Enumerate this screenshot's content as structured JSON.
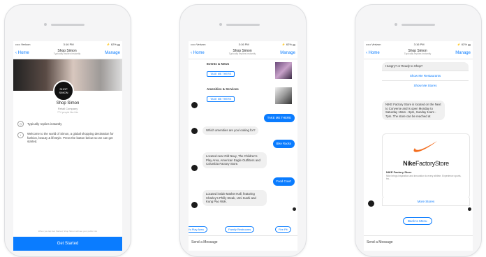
{
  "status": {
    "carrier": "••••• Verizon",
    "time": "3:16 PM",
    "battery": "⚡ 62% ▬"
  },
  "nav": {
    "back": "Home",
    "manage": "Manage",
    "title": "Shop Simon",
    "subtitle": "Typically replies instantly"
  },
  "phone1": {
    "logo_line1": "SHOP",
    "logo_line2": "SIMON",
    "page_name": "Shop Simon",
    "page_type": "Retail Company",
    "likes": "774 people like this",
    "replies": "Typically replies instantly",
    "welcome": "Welcome to the world of Simon, a global shopping destination for fashion, beauty & lifestyle. Press the button below so we can get started.",
    "disclaimer": "When you tap Get Started, Shop Simon will see your public info",
    "get_started": "Get Started"
  },
  "phone2": {
    "card1_title": "Events & News",
    "card1_btn": "TAKE ME THERE",
    "card2_title": "Amenities & Services",
    "card2_btn": "TAKE ME THERE",
    "out1": "TAKE ME THERE",
    "in1": "Which amenities are you looking for?",
    "out2": "Bike Racks",
    "in2": "Located near Old Navy, The Children's Play Area, American Eagle Outfitters and Columbia Factory Store.",
    "out3": "Food Court",
    "in3": "Located inside Market Hall, featuring Charley's Philly Steak, Umi Sushi and Kung Pao Wok.",
    "qr1": "Kid's Play Area",
    "qr2": "Family Restrooms",
    "qr3": "Fire Pit",
    "composer": "Send a Message"
  },
  "phone3": {
    "q": "Hungry? or Ready to Shop?",
    "link1": "Show Me Restaurants",
    "link2": "Show Me Stores",
    "nike_text": "NIKE Factory Store is located on the Next to Converse and is open Monday to Saturday 10am - 9pm, Sunday 11am - 7pm. The store can be reached at",
    "nike_word_a": "Nike",
    "nike_word_b": "FactoryStore",
    "nike_title": "NIKE Factory Store",
    "nike_desc": "Nike brings inspiration and innovation to every athlete. Experience sports, tra...",
    "more_stores": "More Stores",
    "back_menu": "Back to Menu",
    "composer": "Send a Message"
  },
  "colors": {
    "accent": "#0a7cff",
    "bubble": "#f0f0f0",
    "nike_orange": "#f36f21"
  }
}
